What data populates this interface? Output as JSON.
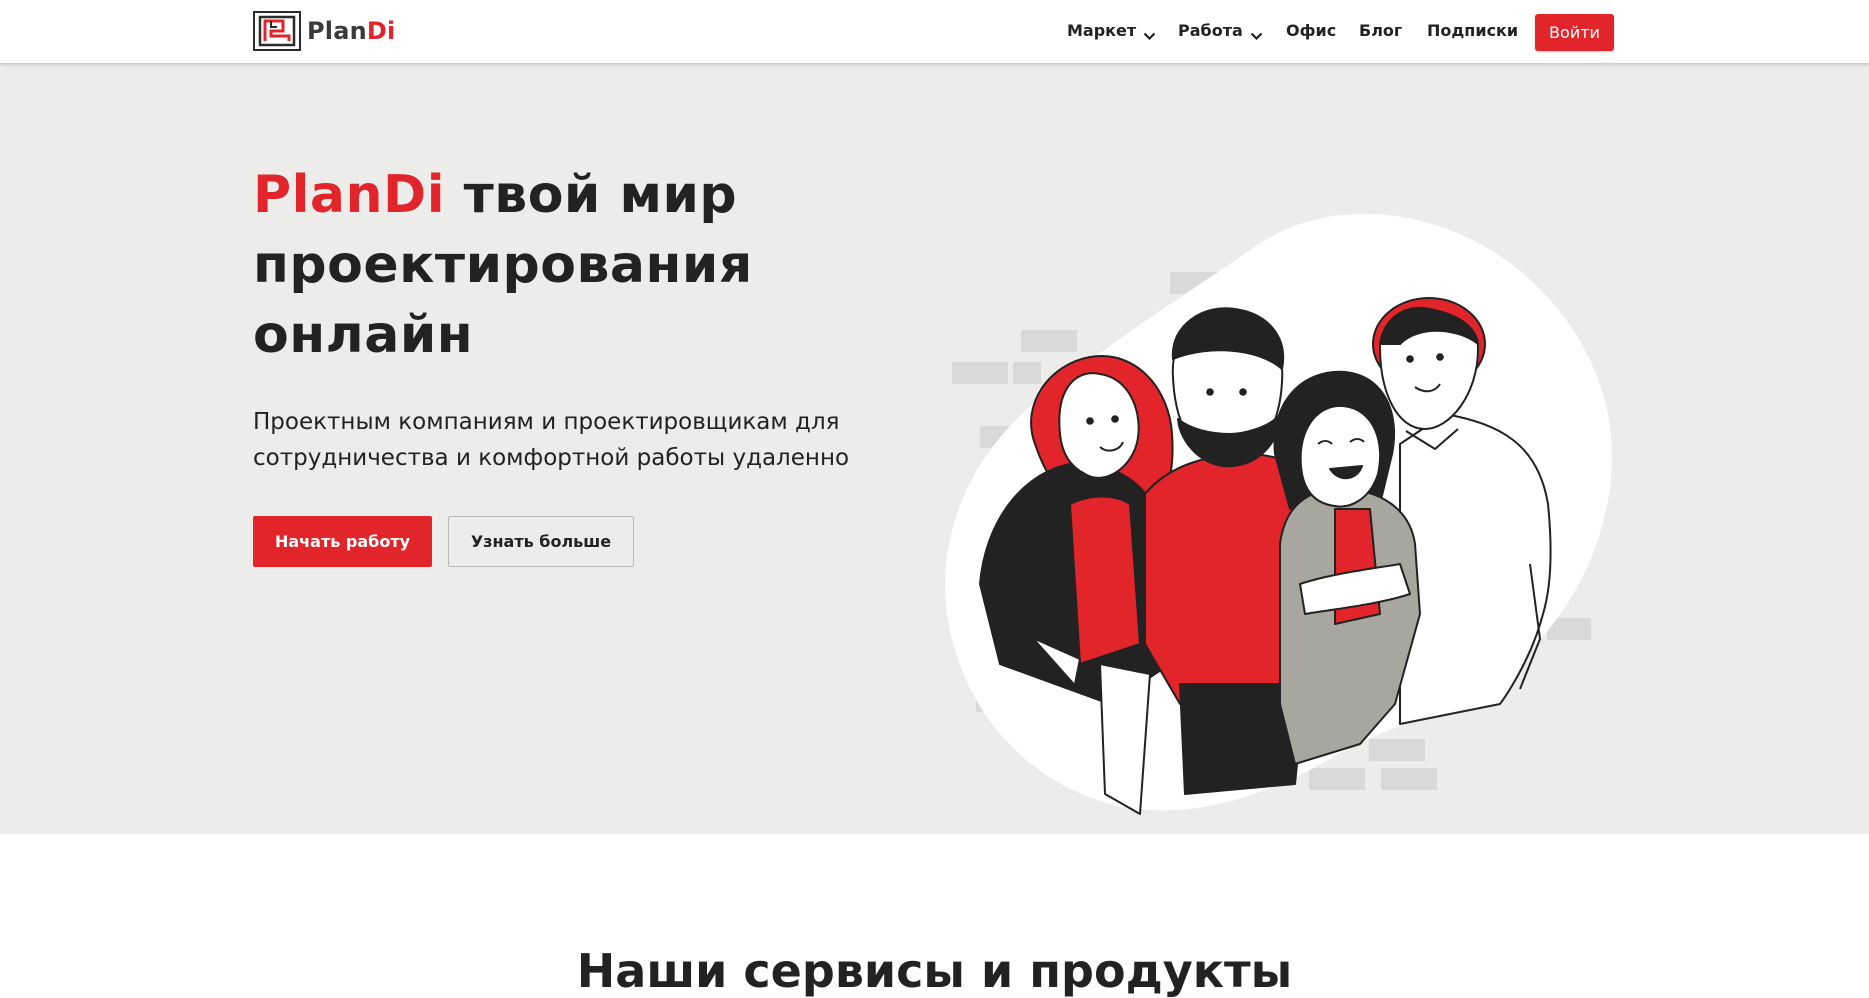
{
  "brand": {
    "name_part1": "Plan",
    "name_part2": "Di",
    "accent_color": "#e2252b",
    "dark_color": "#222222"
  },
  "nav": {
    "items": [
      {
        "label": "Маркет",
        "has_dropdown": true
      },
      {
        "label": "Работа",
        "has_dropdown": true
      },
      {
        "label": "Офис",
        "has_dropdown": false
      },
      {
        "label": "Блог",
        "has_dropdown": false
      },
      {
        "label": "Подписки",
        "has_dropdown": false
      }
    ],
    "login_label": "Войти"
  },
  "hero": {
    "title_brand": "PlanDi",
    "title_rest": " твой мир проектирования онлайн",
    "subtitle": "Проектным компаниям и проектировщикам для сотрудничества и комфортной работы удаленно",
    "primary_cta": "Начать работу",
    "secondary_cta": "Узнать больше",
    "illustration": "team-of-four-people-illustration"
  },
  "services": {
    "title": "Наши сервисы и продукты"
  }
}
